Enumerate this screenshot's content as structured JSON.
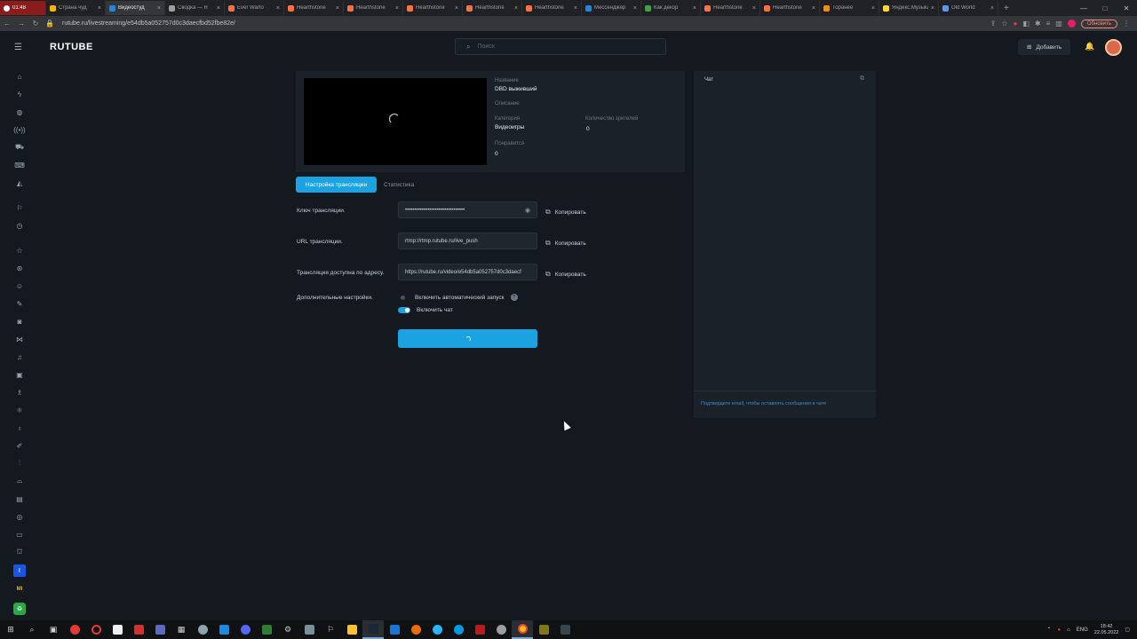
{
  "browser": {
    "recording_time": "01:48",
    "tabs": [
      {
        "title": "Страна чуд",
        "color": "#f4b400"
      },
      {
        "title": "Видеостуд",
        "color": "#1e88e5",
        "active": true
      },
      {
        "title": "Сводка — R",
        "color": "#9e9e9e"
      },
      {
        "title": "Ever Warfo",
        "color": "#ff7043"
      },
      {
        "title": "Hearthstone",
        "color": "#ff7043"
      },
      {
        "title": "Hearthstone",
        "color": "#ff7043"
      },
      {
        "title": "Hearthstone",
        "color": "#ff7043"
      },
      {
        "title": "Hearthstone",
        "color": "#ff7043"
      },
      {
        "title": "Hearthstone",
        "color": "#ff7043"
      },
      {
        "title": "Мессенджер",
        "color": "#1e88e5"
      },
      {
        "title": "Как декор",
        "color": "#43a047"
      },
      {
        "title": "Hearthstone",
        "color": "#ff7043"
      },
      {
        "title": "Hearthstone",
        "color": "#ff7043"
      },
      {
        "title": "Торанее",
        "color": "#fb8c00"
      },
      {
        "title": "Яндекс.Музыка",
        "color": "#fdd835"
      },
      {
        "title": "Old World",
        "color": "#5e97f6"
      }
    ],
    "url": "rutube.ru/livestreaming/e54db5a052757d0c3daecfbd52fbe82e/",
    "update_label": "Обновить"
  },
  "header": {
    "logo": "RUTUBE",
    "search_placeholder": "Поиск",
    "add_label": "Добавить"
  },
  "stream_info": {
    "title_label": "Название",
    "title_value": "DBD выживший",
    "description_label": "Описание",
    "category_label": "Категория",
    "category_value": "Видеоигры",
    "views_label": "Количество зрителей",
    "views_value": "0",
    "likes_label": "Понравится",
    "likes_value": "0"
  },
  "tabs": {
    "settings": "Настройка трансляции",
    "stats": "Статистика"
  },
  "settings": {
    "key_label": "Ключ трансляции.",
    "key_value": "••••••••••••••••••••••••••••••••",
    "url_label": "URL трансляции.",
    "url_value": "rtmp://rtmp.rutube.ru/live_push",
    "address_label": "Трансляция доступна по адресу.",
    "address_value": "https://rutube.ru/video/e54db5a052757d0c3daecf",
    "copy_label": "Копировать",
    "extra_label": "Дополнительные настройки.",
    "autostart_label": "Включить автоматический запуск",
    "chat_toggle_label": "Включить чат",
    "help_glyph": "?"
  },
  "chat": {
    "title": "Чат",
    "note": "Подтвердите email, чтобы оставлять сообщения в чате"
  },
  "taskbar": {
    "lang": "ENG",
    "time": "18:42",
    "date": "22.05.2022"
  }
}
